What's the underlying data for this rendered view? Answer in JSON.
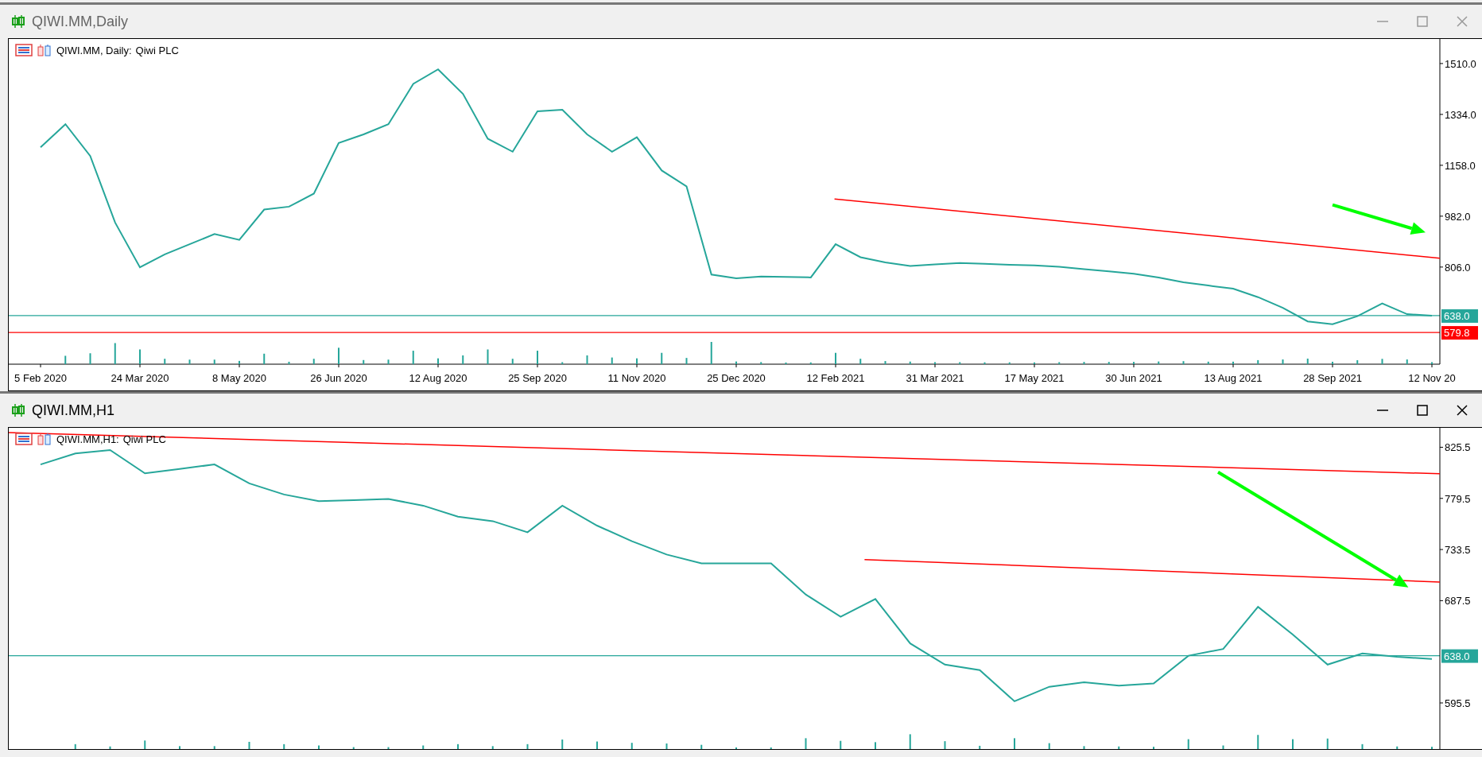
{
  "windows": [
    {
      "title": "QIWI.MM,Daily",
      "active": false,
      "chart_header": {
        "symbol": "QIWI.MM, Daily:",
        "company": "Qiwi PLC"
      },
      "chart_data": {
        "type": "line",
        "ylim": [
          470,
          1595
        ],
        "categories": [
          "5 Feb 2020",
          null,
          null,
          null,
          "24 Mar 2020",
          null,
          null,
          null,
          "8 May 2020",
          null,
          null,
          null,
          "26 Jun 2020",
          null,
          null,
          null,
          "12 Aug 2020",
          null,
          null,
          null,
          "25 Sep 2020",
          null,
          null,
          null,
          "11 Nov 2020",
          null,
          null,
          null,
          "25 Dec 2020",
          null,
          null,
          null,
          "12 Feb 2021",
          null,
          null,
          null,
          "31 Mar 2021",
          null,
          null,
          null,
          "17 May 2021",
          null,
          null,
          null,
          "30 Jun 2021",
          null,
          null,
          null,
          "13 Aug 2021",
          null,
          null,
          null,
          "28 Sep 2021",
          null,
          null,
          null,
          "12 Nov 20"
        ],
        "yticks": [
          {
            "value": 806,
            "label": "806.0"
          },
          {
            "value": 982,
            "label": "982.0"
          },
          {
            "value": 1158,
            "label": "1158.0"
          },
          {
            "value": 1334,
            "label": "1334.0"
          },
          {
            "value": 1510,
            "label": "1510.0"
          }
        ],
        "series": [
          {
            "color": "#26a69a",
            "values": [
              1220,
              1300,
              1190,
              960,
              805,
              850,
              885,
              920,
              900,
              1005,
              1015,
              1060,
              1235,
              1265,
              1300,
              1440,
              1490,
              1405,
              1250,
              1205,
              1345,
              1350,
              1265,
              1205,
              1255,
              1140,
              1085,
              780,
              767,
              773,
              772,
              770,
              885,
              840,
              822,
              810,
              815,
              820,
              817,
              814,
              812,
              807,
              799,
              791,
              783,
              770,
              753,
              742,
              731,
              702,
              665,
              618,
              608,
              636,
              680,
              643,
              638
            ]
          }
        ],
        "ref_lines": [
          {
            "axis": "y",
            "value": 638,
            "label": "638.0",
            "color": "#26a69a"
          },
          {
            "axis": "y",
            "value": 579.8,
            "label": "579.8",
            "color": "#ff0000"
          }
        ]
      }
    },
    {
      "title": "QIWI.MM,H1",
      "active": true,
      "chart_header": {
        "symbol": "QIWI.MM,H1:",
        "company": "Qiwi PLC"
      },
      "chart_data": {
        "type": "line",
        "ylim": [
          554,
          843
        ],
        "categories": [
          null,
          null,
          null,
          null,
          null,
          null,
          null,
          null,
          null,
          null,
          null,
          null,
          null,
          null,
          null,
          null,
          null,
          null,
          null,
          null,
          null,
          null,
          null,
          null,
          null,
          null,
          null,
          null,
          null,
          null,
          null,
          null,
          null,
          null,
          null,
          null,
          null,
          null,
          null,
          null,
          null
        ],
        "yticks": [
          {
            "value": 595.5,
            "label": "595.5"
          },
          {
            "value": 687.5,
            "label": "687.5"
          },
          {
            "value": 733.5,
            "label": "733.5"
          },
          {
            "value": 779.5,
            "label": "779.5"
          },
          {
            "value": 825.5,
            "label": "825.5"
          }
        ],
        "series": [
          {
            "color": "#26a69a",
            "values": [
              810,
              820,
              823,
              802,
              806,
              810,
              793,
              783,
              777,
              778,
              779,
              773,
              763,
              759,
              749,
              773,
              755,
              741,
              729,
              721,
              721,
              721,
              693,
              673,
              689,
              649,
              630,
              625,
              597,
              610,
              614,
              611,
              613,
              638,
              644,
              682,
              657,
              630,
              640,
              637,
              635
            ]
          }
        ],
        "ref_lines": [
          {
            "axis": "y",
            "value": 638,
            "label": "638.0",
            "color": "#26a69a"
          }
        ]
      }
    }
  ]
}
